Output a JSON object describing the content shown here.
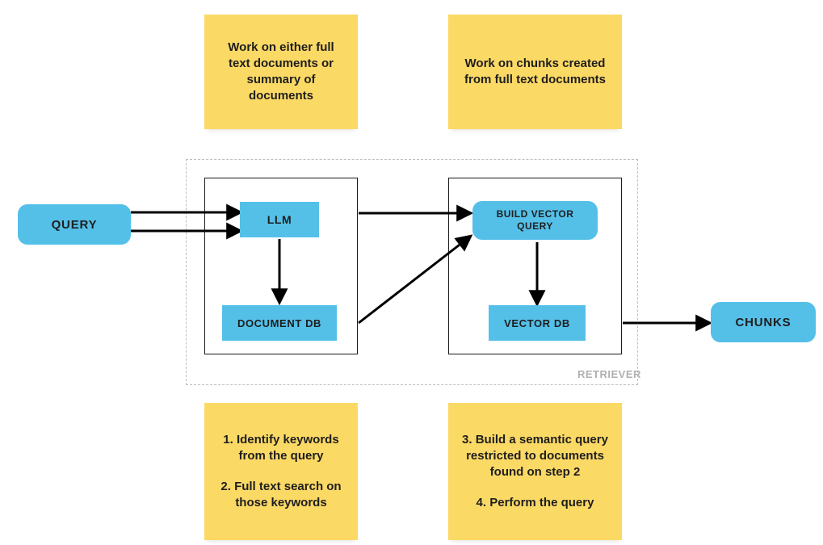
{
  "colors": {
    "accent_blue": "#54c0e8",
    "sticky_yellow": "#fbd965"
  },
  "nodes": {
    "query": "QUERY",
    "llm": "LLM",
    "document_db": "DOCUMENT DB",
    "build_vector_query": "BUILD VECTOR QUERY",
    "vector_db": "VECTOR DB",
    "chunks": "CHUNKS"
  },
  "retriever_label": "RETRIEVER",
  "notes": {
    "top_left": "Work on either full text documents or summary of documents",
    "top_right": "Work on chunks created from full text documents",
    "bottom_left_1": "1. Identify keywords from the query",
    "bottom_left_2": "2. Full text search on those keywords",
    "bottom_right_1": "3. Build a semantic query restricted to documents found on step 2",
    "bottom_right_2": "4. Perform the query"
  }
}
